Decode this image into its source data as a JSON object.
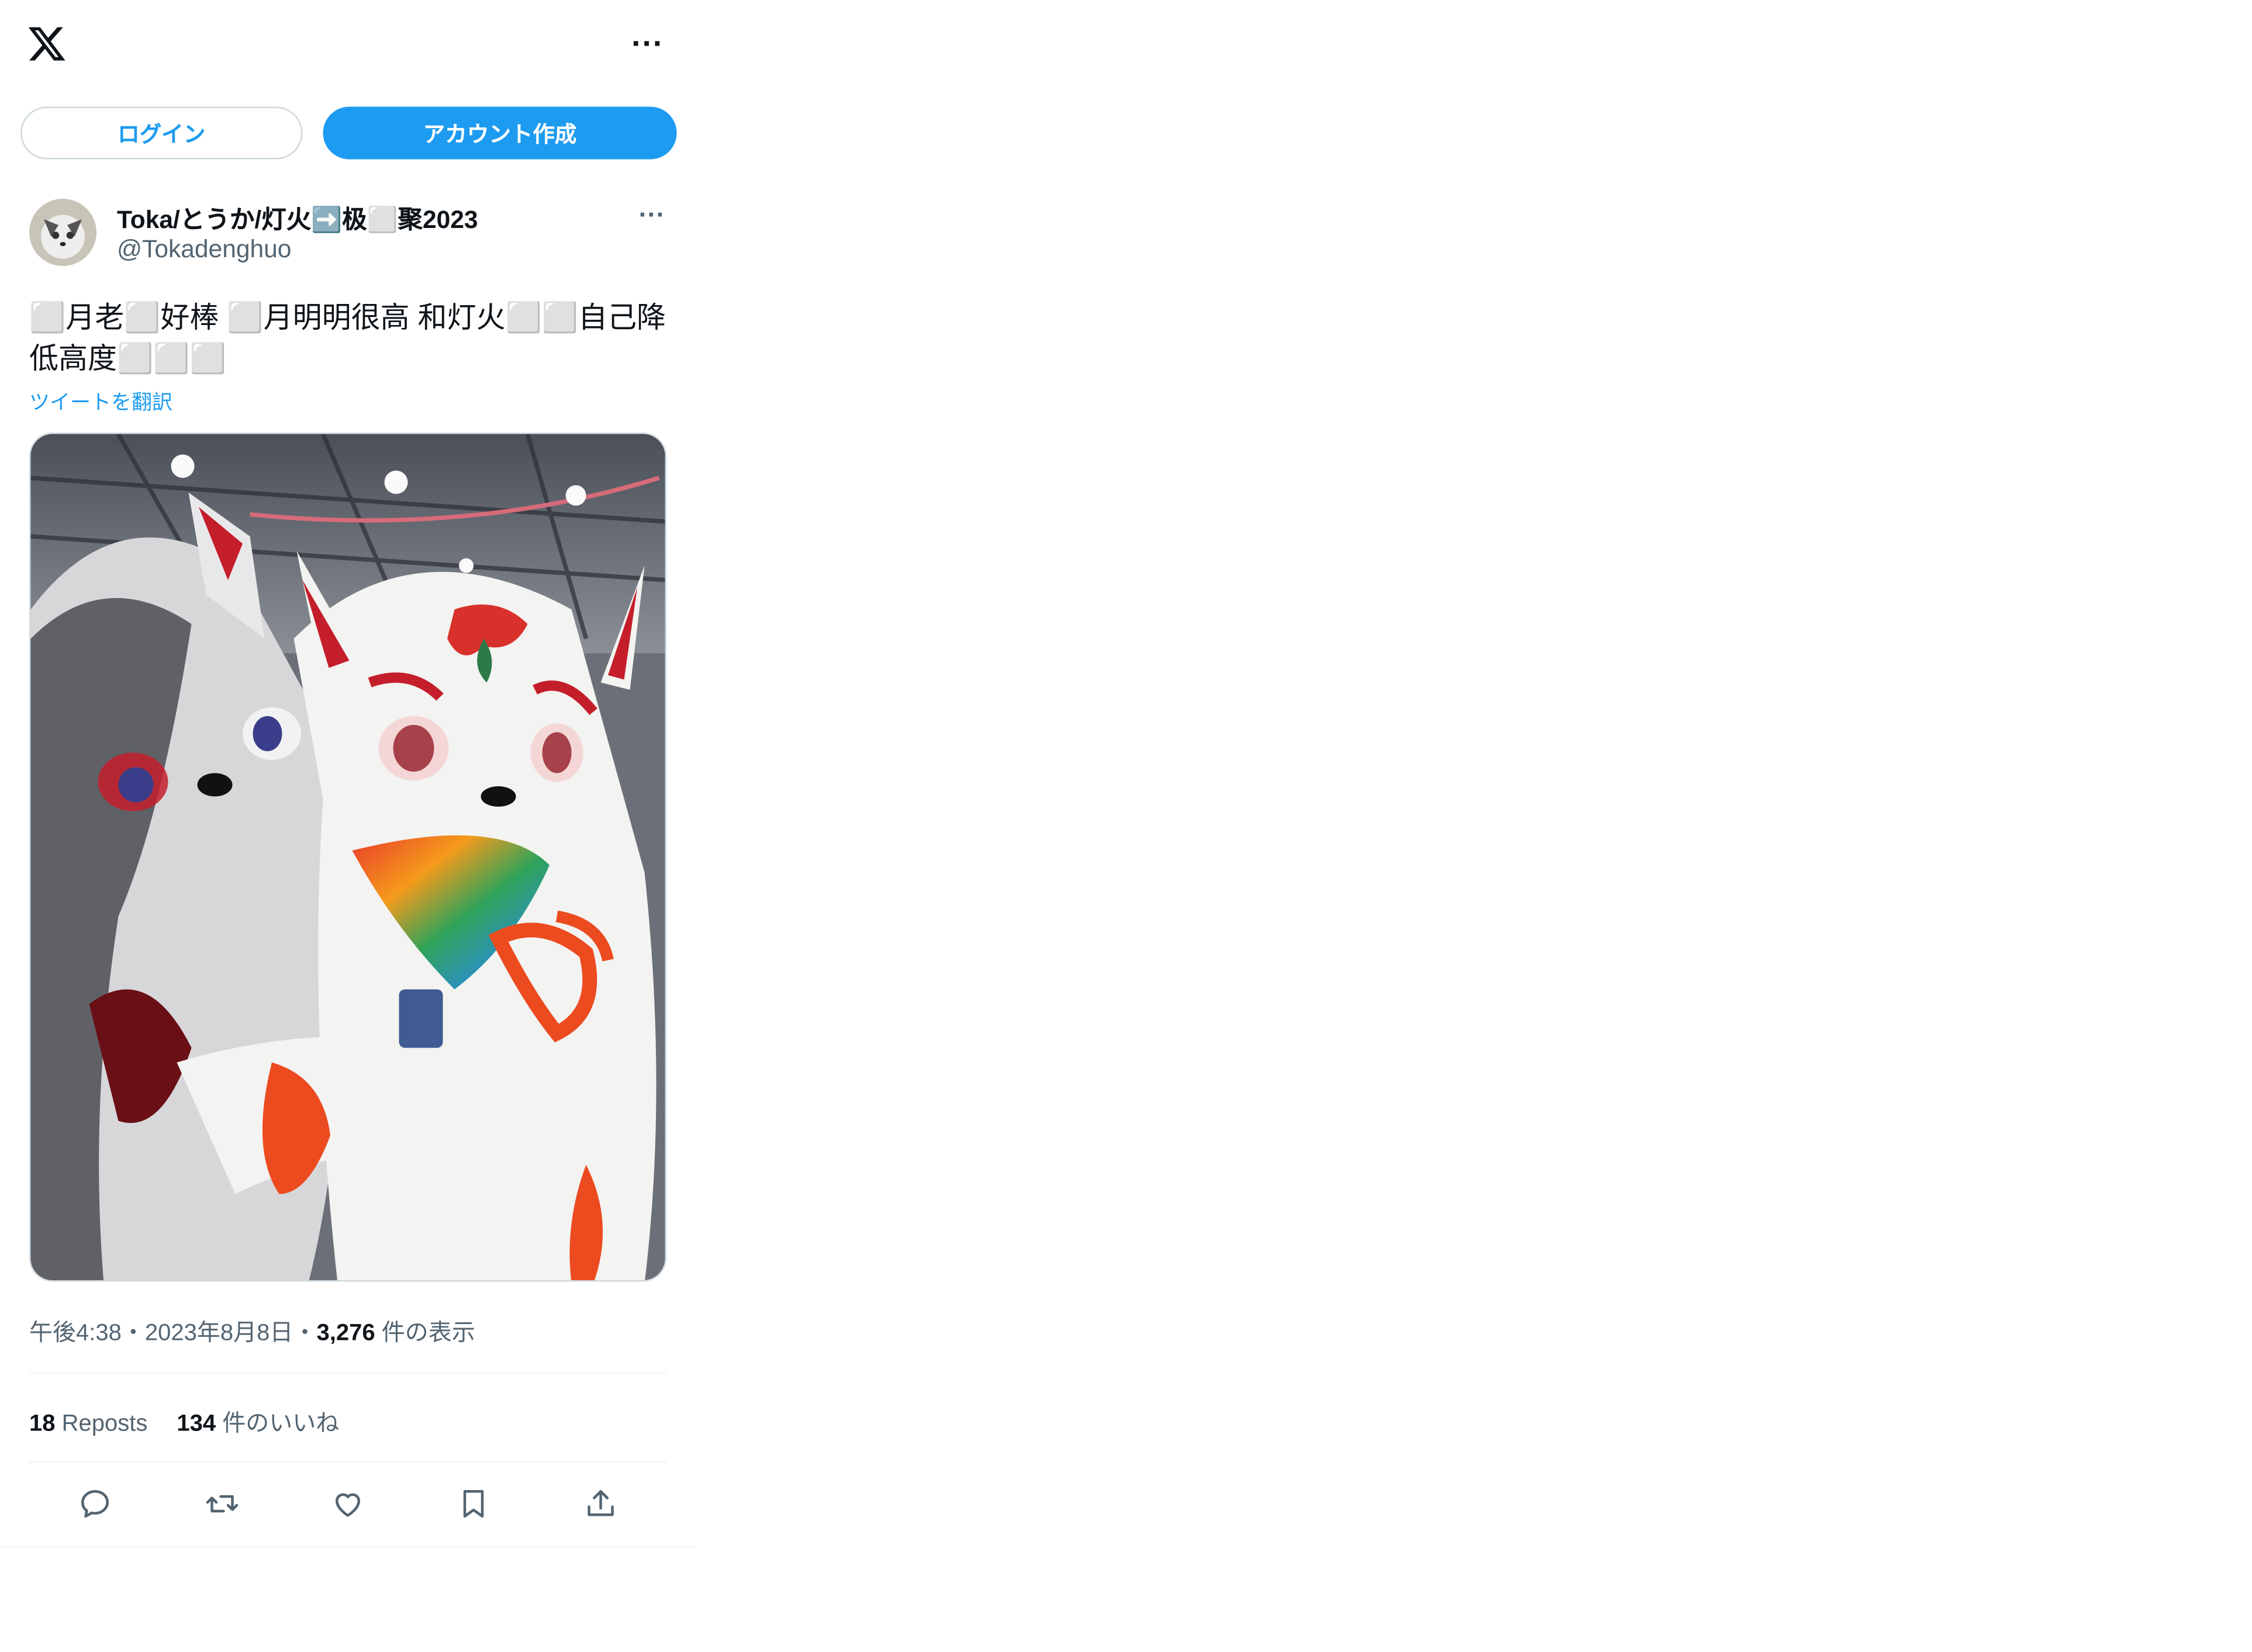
{
  "topbar": {
    "logo_icon": "x-logo-icon",
    "more_icon": "more-horizontal-icon",
    "more_label": "···"
  },
  "auth": {
    "login_label": "ログイン",
    "signup_label": "アカウント作成"
  },
  "tweet": {
    "display_name": "Toka/とうか/灯火➡️极⬜聚2023",
    "handle": "@Tokadenghuo",
    "more_label": "···",
    "text": "⬜月老⬜好棒 ⬜月明明很高 和灯火⬜⬜自己降低高度⬜⬜⬜",
    "translate_label": "ツイートを翻訳",
    "media_alt": "furry costume photo",
    "time": "午後4:38",
    "date": "2023年8月8日",
    "sep": "・",
    "views_count": "3,276",
    "views_label": "件の表示",
    "reposts_count": "18",
    "reposts_label": "Reposts",
    "likes_count": "134",
    "likes_label": "件のいいね"
  },
  "actions": [
    {
      "name": "reply-icon"
    },
    {
      "name": "repost-icon"
    },
    {
      "name": "like-icon"
    },
    {
      "name": "bookmark-icon"
    },
    {
      "name": "share-icon"
    }
  ],
  "colors": {
    "accent": "#1d9bf0",
    "text": "#0f1419",
    "secondary": "#536471",
    "border": "#cfd9de"
  }
}
